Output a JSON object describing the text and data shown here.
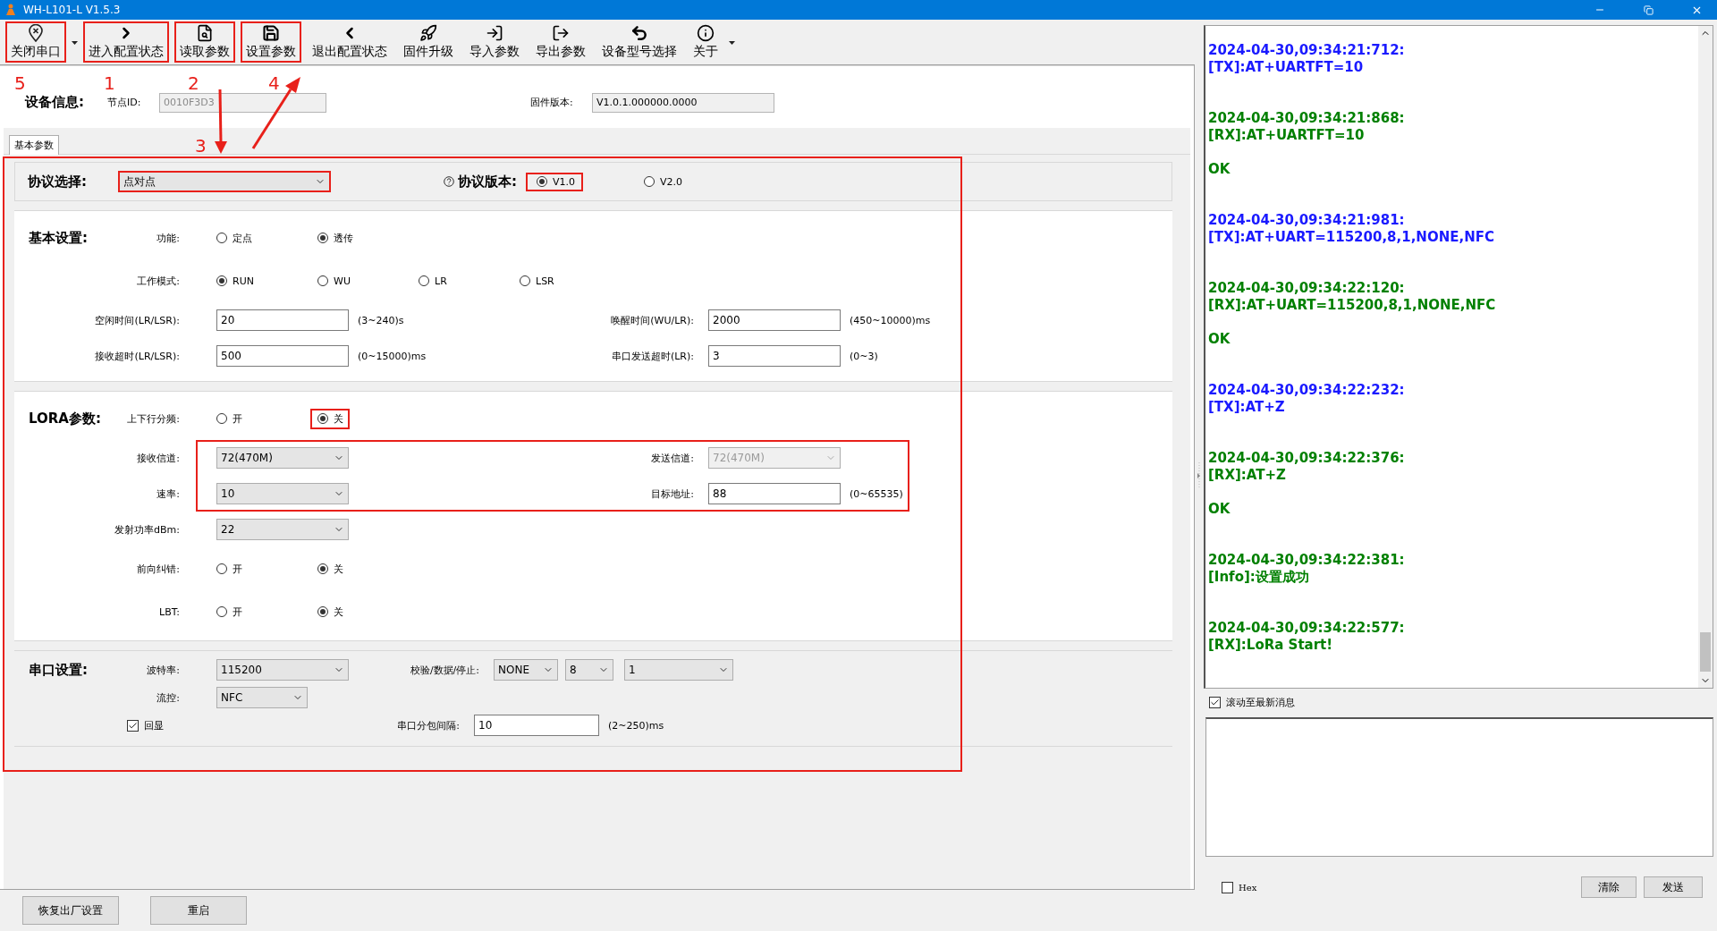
{
  "window": {
    "title": "WH-L101-L V1.5.3"
  },
  "toolbar": [
    {
      "label": "关闭串口",
      "highlighted": true,
      "menu": true
    },
    {
      "label": "进入配置状态",
      "highlighted": true,
      "menu": false
    },
    {
      "label": "读取参数",
      "highlighted": true,
      "menu": false
    },
    {
      "label": "设置参数",
      "highlighted": true,
      "menu": false
    },
    {
      "label": "退出配置状态",
      "highlighted": false,
      "menu": false
    },
    {
      "label": "固件升级",
      "highlighted": false,
      "menu": false
    },
    {
      "label": "导入参数",
      "highlighted": false,
      "menu": false
    },
    {
      "label": "导出参数",
      "highlighted": false,
      "menu": false
    },
    {
      "label": "设备型号选择",
      "highlighted": false,
      "menu": false
    },
    {
      "label": "关于",
      "highlighted": false,
      "menu": true
    }
  ],
  "annotations": [
    {
      "label": "5"
    },
    {
      "label": "1"
    },
    {
      "label": "2"
    },
    {
      "label": "4"
    },
    {
      "label": "3"
    }
  ],
  "device_info": {
    "title": "设备信息:",
    "fields": [
      {
        "label": "节点ID:",
        "value": "0010F3D3",
        "disabled": true
      },
      {
        "label": "固件版本:",
        "value": "V1.0.1.000000.0000",
        "disabled": false
      }
    ]
  },
  "tabs": [
    {
      "label": "基本参数",
      "selected": true
    }
  ],
  "settings": {
    "highlighted": true,
    "protocol": {
      "label": "协议选择:",
      "value": "点对点",
      "highlighted": true,
      "version_label": "协议版本:",
      "versions": [
        {
          "label": "V1.0",
          "selected": true,
          "highlighted": true
        },
        {
          "label": "V2.0",
          "selected": false,
          "highlighted": false
        }
      ]
    },
    "sections": [
      {
        "title": "基本设置:",
        "rows": [
          {
            "kind": "radio",
            "label": "功能:",
            "options": [
              {
                "label": "定点",
                "selected": false,
                "highlighted": false
              },
              {
                "label": "透传",
                "selected": true,
                "highlighted": false
              }
            ]
          },
          {
            "kind": "radio",
            "label": "工作模式:",
            "options": [
              {
                "label": "RUN",
                "selected": true,
                "highlighted": false
              },
              {
                "label": "WU",
                "selected": false,
                "highlighted": false
              },
              {
                "label": "LR",
                "selected": false,
                "highlighted": false
              },
              {
                "label": "LSR",
                "selected": false,
                "highlighted": false
              }
            ]
          },
          {
            "kind": "pair",
            "left": {
              "label": "空闲时间(LR/LSR):",
              "kind": "input",
              "value": "20",
              "hint": "(3~240)s"
            },
            "right": {
              "label": "唤醒时间(WU/LR):",
              "kind": "input",
              "value": "2000",
              "hint": "(450~10000)ms"
            }
          },
          {
            "kind": "pair",
            "left": {
              "label": "接收超时(LR/LSR):",
              "kind": "input",
              "value": "500",
              "hint": "(0~15000)ms"
            },
            "right": {
              "label": "串口发送超时(LR):",
              "kind": "input",
              "value": "3",
              "hint": "(0~3)"
            }
          }
        ]
      },
      {
        "title": "LORA参数:",
        "rows": [
          {
            "kind": "radio",
            "label": "上下行分频:",
            "options": [
              {
                "label": "开",
                "selected": false,
                "highlighted": false
              },
              {
                "label": "关",
                "selected": true,
                "highlighted": true
              }
            ]
          },
          {
            "kind": "group",
            "highlighted": true,
            "rows": [
              {
                "kind": "pair",
                "left": {
                  "label": "接收信道:",
                  "kind": "select",
                  "value": "72(470M)"
                },
                "right": {
                  "label": "发送信道:",
                  "kind": "select",
                  "value": "72(470M)",
                  "disabled": true
                }
              },
              {
                "kind": "pair",
                "left": {
                  "label": "速率:",
                  "kind": "select",
                  "value": "10"
                },
                "right": {
                  "label": "目标地址:",
                  "kind": "input",
                  "value": "88",
                  "hint": "(0~65535)"
                }
              }
            ]
          },
          {
            "kind": "pair",
            "left": {
              "label": "发射功率dBm:",
              "kind": "select",
              "value": "22"
            }
          },
          {
            "kind": "radio",
            "label": "前向纠错:",
            "options": [
              {
                "label": "开",
                "selected": false,
                "highlighted": false
              },
              {
                "label": "关",
                "selected": true,
                "highlighted": false
              }
            ]
          },
          {
            "kind": "radio",
            "label": "LBT:",
            "options": [
              {
                "label": "开",
                "selected": false,
                "highlighted": false
              },
              {
                "label": "关",
                "selected": true,
                "highlighted": false
              }
            ]
          }
        ]
      }
    ],
    "serial": {
      "title": "串口设置:",
      "baud_label": "波特率:",
      "baud": "115200",
      "format_label": "校验/数据/停止:",
      "parity": "NONE",
      "data_bits": "8",
      "stop_bits": "1",
      "flow_label": "流控:",
      "flow": "NFC",
      "echo": {
        "label": "回显",
        "checked": true
      },
      "interval_label": "串口分包间隔:",
      "interval": "10",
      "interval_hint": "(2~250)ms"
    }
  },
  "bottom_buttons": [
    "恢复出厂设置",
    "重启"
  ],
  "log": [
    {
      "kind": "tx",
      "time": "2024-04-30,09:34:21:712:",
      "message": "[TX]:AT+UARTFT=10"
    },
    {
      "kind": "rx",
      "time": "2024-04-30,09:34:21:868:",
      "message": "[RX]:AT+UARTFT=10",
      "reply": "OK"
    },
    {
      "kind": "tx",
      "time": "2024-04-30,09:34:21:981:",
      "message": "[TX]:AT+UART=115200,8,1,NONE,NFC"
    },
    {
      "kind": "rx",
      "time": "2024-04-30,09:34:22:120:",
      "message": "[RX]:AT+UART=115200,8,1,NONE,NFC",
      "reply": "OK"
    },
    {
      "kind": "tx",
      "time": "2024-04-30,09:34:22:232:",
      "message": "[TX]:AT+Z"
    },
    {
      "kind": "rx",
      "time": "2024-04-30,09:34:22:376:",
      "message": "[RX]:AT+Z",
      "reply": "OK"
    },
    {
      "kind": "rx",
      "time": "2024-04-30,09:34:22:381:",
      "message": "[Info]:设置成功"
    },
    {
      "kind": "rx",
      "time": "2024-04-30,09:34:22:577:",
      "message": "[RX]:LoRa Start!"
    }
  ],
  "auto_scroll": {
    "label": "滚动至最新消息",
    "checked": true
  },
  "hex": {
    "label": "Hex",
    "checked": false
  },
  "send_buttons": [
    "清除",
    "发送"
  ]
}
